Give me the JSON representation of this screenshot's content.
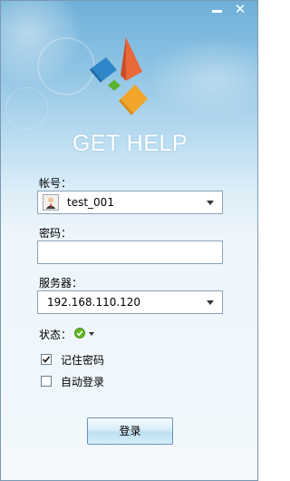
{
  "window": {
    "minimize_icon": "minimize-icon",
    "close_symbol": "✕"
  },
  "app": {
    "title": "GET HELP",
    "logo_colors": {
      "top_right": "#e8683a",
      "left": "#2f86c9",
      "middle": "#5cb32d",
      "bottom": "#f2a52b"
    }
  },
  "account": {
    "label": "帐号：",
    "value": "test_001",
    "icon": "user-avatar-icon"
  },
  "password": {
    "label": "密码：",
    "value": ""
  },
  "server": {
    "label": "服务器：",
    "value": "192.168.110.120"
  },
  "status": {
    "label": "状态：",
    "icon": "online-status-icon",
    "color": "#62b826"
  },
  "remember_password": {
    "label": "记住密码",
    "checked": true
  },
  "auto_login": {
    "label": "自动登录",
    "checked": false
  },
  "login_button": {
    "label": "登录"
  }
}
